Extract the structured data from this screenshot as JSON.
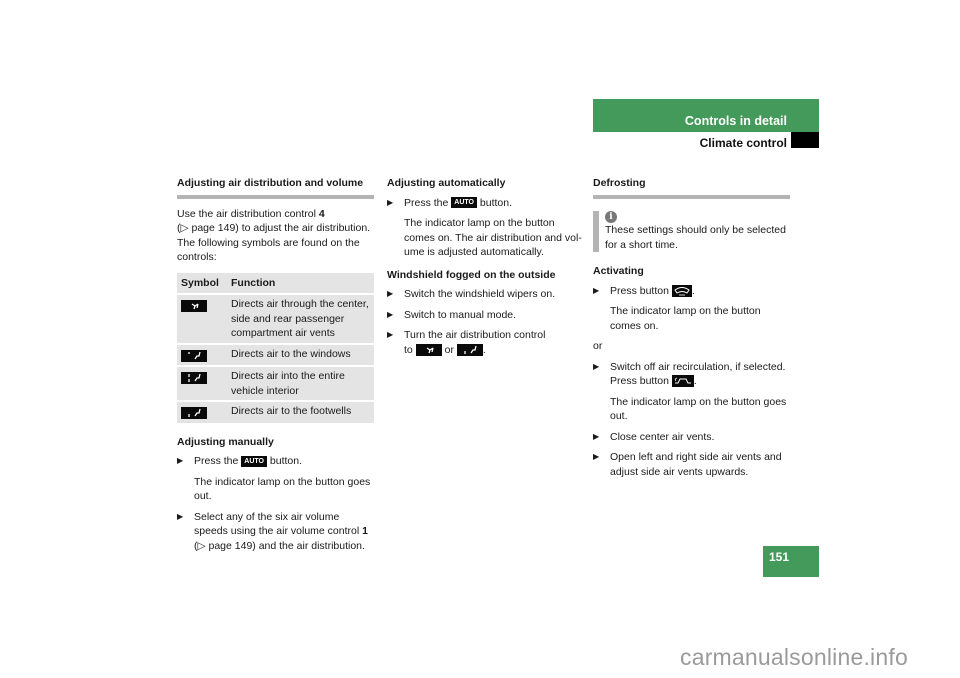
{
  "header": {
    "section": "Controls in detail",
    "subsection": "Climate control",
    "accent_color": "#449a5a"
  },
  "col1": {
    "title": "Adjusting air distribution and volume",
    "intro": "Use the air distribution control",
    "intro_ref": "4",
    "intro_rest_1": "(▷ page 149) to adjust the air distribution.",
    "intro_rest_2": "The following symbols are found on the controls:",
    "table": {
      "headers": [
        "Symbol",
        "Function"
      ],
      "rows": [
        {
          "symbol": "air-vents-symbol",
          "function": "Directs air through the center, side and rear passenger compartment air vents"
        },
        {
          "symbol": "windows-symbol",
          "function": "Directs air to the windows"
        },
        {
          "symbol": "entire-interior-symbol",
          "function": "Directs air into the entire vehicle interior"
        },
        {
          "symbol": "footwells-symbol",
          "function": "Directs air to the footwells"
        }
      ]
    },
    "manual_title": "Adjusting manually",
    "manual_step1_pre": "Press the",
    "manual_step1_btn": "AUTO",
    "manual_step1_post": "button.",
    "manual_step1_result": "The indicator lamp on the button goes out.",
    "manual_step2_pre": "Select any of the six air volume speeds using the air volume control",
    "manual_step2_ref": "1",
    "manual_step2_post": "(▷ page 149) and the air distribution."
  },
  "col2": {
    "auto_title": "Adjusting automatically",
    "auto_step_pre": "Press the",
    "auto_step_btn": "AUTO",
    "auto_step_post": "button.",
    "auto_result": "The indicator lamp on the button comes on. The air distribution and vol-ume is adjusted automatically.",
    "fog_title": "Windshield fogged on the outside",
    "fog_steps": [
      "Switch the windshield wipers on.",
      "Switch to manual mode.",
      "Turn the air distribution control"
    ],
    "fog_step3_to": "to",
    "fog_step3_or": "or"
  },
  "col3": {
    "title": "Defrosting",
    "note": "These settings should only be selected for a short time.",
    "activating_title": "Activating",
    "step1_pre": "Press button",
    "step1_result": "The indicator lamp on the button comes on.",
    "or": "or",
    "step2": "Switch off air recirculation, if selected.",
    "step2_press": "Press button",
    "step2_result": "The indicator lamp on the button goes out.",
    "step3": "Close center air vents.",
    "step4": "Open left and right side air vents and adjust side air vents upwards."
  },
  "page_number": "151",
  "watermark": "carmanualsonline.info"
}
